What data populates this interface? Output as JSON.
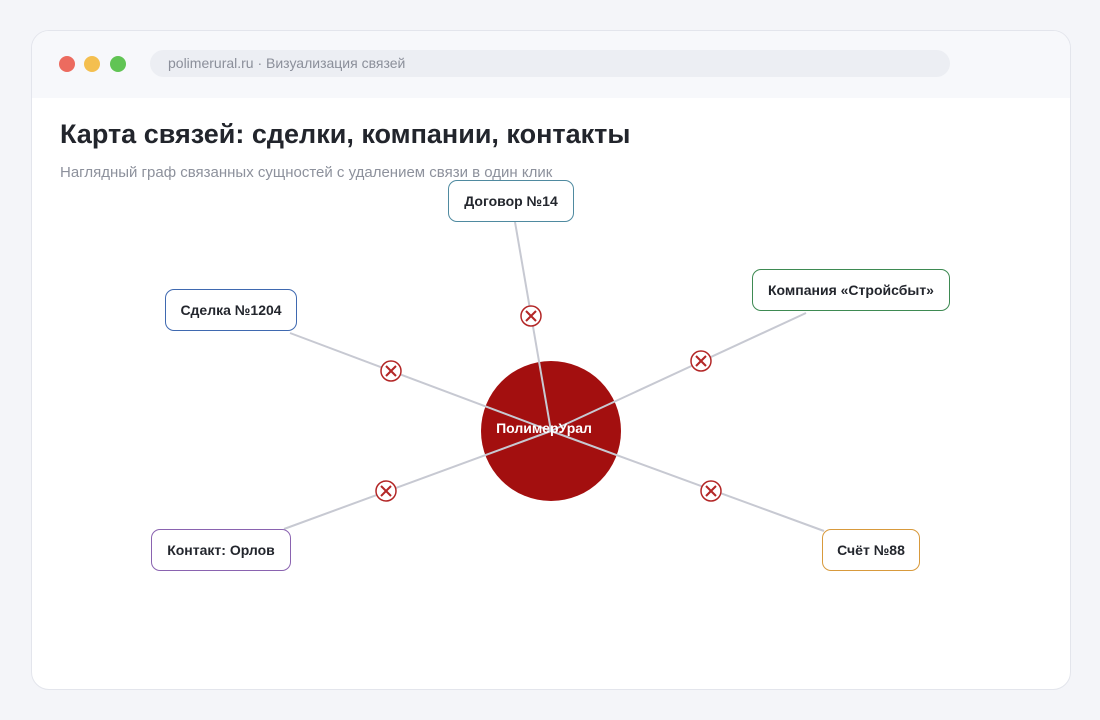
{
  "browser": {
    "address": "polimerural.ru · Визуализация связей"
  },
  "page": {
    "title": "Карта связей: сделки, компании, контакты",
    "subtitle": "Наглядный граф связанных сущностей с удалением связи в один клик"
  },
  "graph": {
    "center": {
      "label": "ПолимерУрал",
      "color": "#a30f0f"
    },
    "nodes": [
      {
        "id": "contract",
        "label": "Договор №14",
        "border_color": "#4f8aa0"
      },
      {
        "id": "company",
        "label": "Компания «Стройсбыт»",
        "border_color": "#3e8a52"
      },
      {
        "id": "deal",
        "label": "Сделка №1204",
        "border_color": "#3f69b0"
      },
      {
        "id": "contact",
        "label": "Контакт: Орлов",
        "border_color": "#8a63b0"
      },
      {
        "id": "invoice",
        "label": "Счёт №88",
        "border_color": "#d89a3c"
      }
    ],
    "delete_button": {
      "icon": "close-icon",
      "color": "#b32626"
    }
  }
}
